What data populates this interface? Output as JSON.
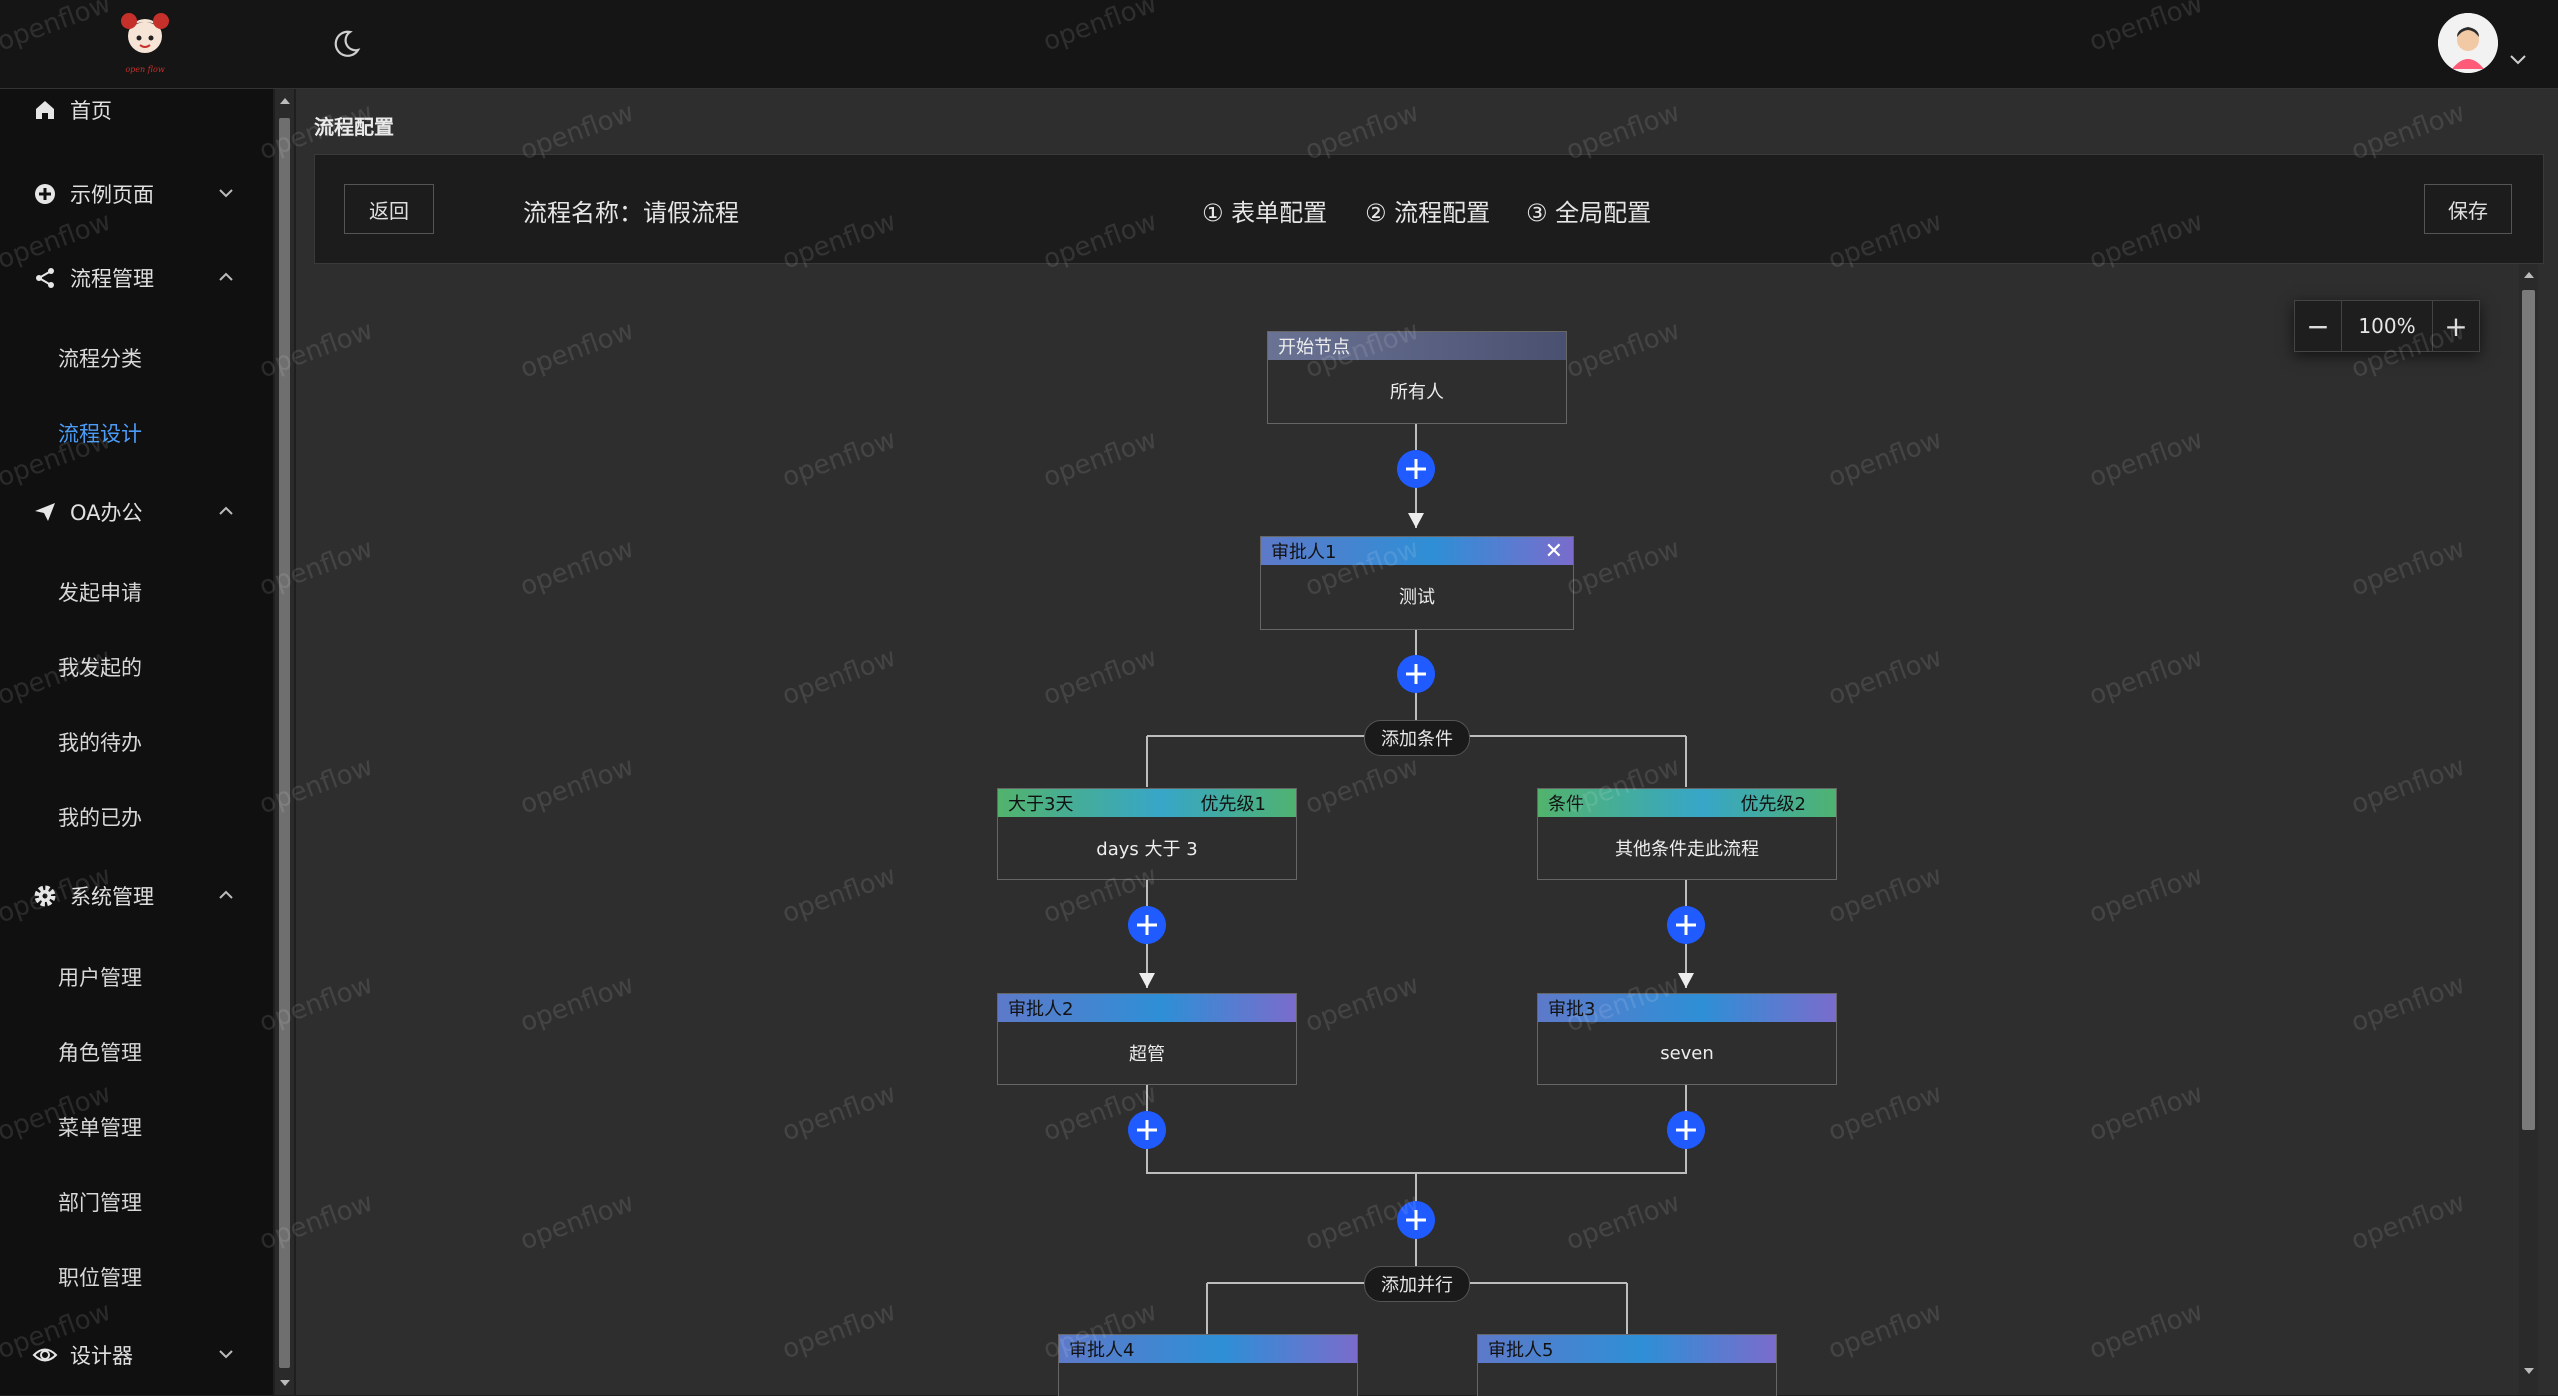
{
  "logo_text": "open flow",
  "sidebar": {
    "items": [
      {
        "label": "首页"
      },
      {
        "label": "示例页面"
      },
      {
        "label": "流程管理"
      },
      {
        "label": "OA办公"
      },
      {
        "label": "系统管理"
      },
      {
        "label": "设计器"
      }
    ],
    "sub_flow": [
      "流程分类",
      "流程设计"
    ],
    "sub_oa": [
      "发起申请",
      "我发起的",
      "我的待办",
      "我的已办"
    ],
    "sub_system": [
      "用户管理",
      "角色管理",
      "菜单管理",
      "部门管理",
      "职位管理"
    ]
  },
  "page": {
    "title": "流程配置"
  },
  "toolbar": {
    "back_label": "返回",
    "flow_name": "流程名称：请假流程",
    "steps": [
      "① 表单配置",
      "② 流程配置",
      "③ 全局配置"
    ],
    "save_label": "保存"
  },
  "zoom": {
    "minus": "−",
    "value": "100%",
    "plus": "+"
  },
  "flow": {
    "start": {
      "title": "开始节点",
      "body": "所有人"
    },
    "approver1": {
      "title": "审批人1",
      "body": "测试"
    },
    "add_condition": "添加条件",
    "cond1": {
      "title": "大于3天",
      "priority": "优先级1",
      "body": "days 大于 3"
    },
    "cond2": {
      "title": "条件",
      "priority": "优先级2",
      "body": "其他条件走此流程"
    },
    "approver2": {
      "title": "审批人2",
      "body": "超管"
    },
    "approver3": {
      "title": "审批3",
      "body": "seven"
    },
    "add_parallel": "添加并行",
    "approver4": {
      "title": "审批人4"
    },
    "approver5": {
      "title": "审批人5"
    }
  },
  "watermark": "openflow",
  "colors": {
    "accent": "#4a9cf7",
    "plus": "#1f5bff"
  }
}
